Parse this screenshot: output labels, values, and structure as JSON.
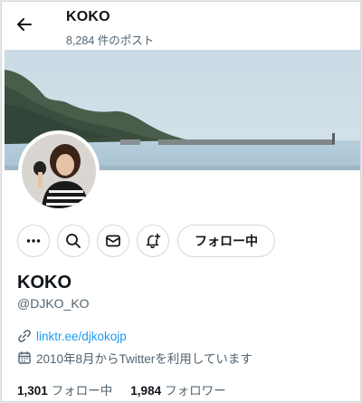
{
  "header": {
    "title": "KOKO",
    "post_count": "8,284 件のポスト"
  },
  "profile": {
    "name": "KOKO",
    "handle": "@DJKO_KO",
    "link": "linktr.ee/djkokojp",
    "joined": "2010年8月からTwitterを利用しています"
  },
  "actions": {
    "follow_label": "フォロー中"
  },
  "stats": {
    "following_count": "1,301",
    "following_label": "フォロー中",
    "followers_count": "1,984",
    "followers_label": "フォロワー"
  },
  "icons": {
    "back": "arrow-left-icon",
    "more": "more-icon",
    "search": "search-icon",
    "message": "envelope-icon",
    "notify": "bell-plus-icon",
    "link": "link-icon",
    "calendar": "calendar-icon"
  },
  "colors": {
    "link": "#1d9bf0",
    "secondary_text": "#536471",
    "border": "#cfd9de"
  }
}
